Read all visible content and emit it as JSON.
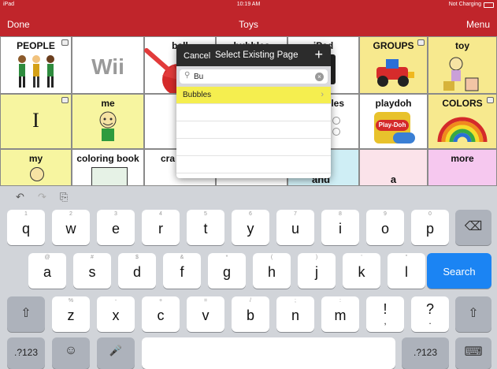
{
  "status_bar": {
    "device": "iPad",
    "time": "10:19 AM",
    "charging": "Not Charging"
  },
  "nav": {
    "done": "Done",
    "title": "Toys",
    "menu": "Menu"
  },
  "grid": {
    "people": "PEOPLE",
    "ball": "ball",
    "bubbles": "bubbles",
    "ipad": "iPad",
    "groups": "GROUPS",
    "toy": "toy",
    "i": "I",
    "me": "me",
    "les": "les",
    "playdoh": "playdoh",
    "colors": "COLORS",
    "my": "my",
    "coloring_book": "coloring book",
    "cra": "cra",
    "and": "and",
    "a": "a",
    "more": "more",
    "wii": "Wii",
    "playdoh_logo": "Play-Doh"
  },
  "popover": {
    "cancel": "Cancel",
    "title": "Select Existing Page",
    "plus": "+",
    "search_value": "Bu",
    "result": "Bubbles",
    "clear": "×",
    "chevron": "›",
    "mag": "⚲"
  },
  "keyboard": {
    "tools": {
      "undo": "↶",
      "redo": "↷",
      "paste": "⎘"
    },
    "row1": [
      {
        "hint": "1",
        "key": "q"
      },
      {
        "hint": "2",
        "key": "w"
      },
      {
        "hint": "3",
        "key": "e"
      },
      {
        "hint": "4",
        "key": "r"
      },
      {
        "hint": "5",
        "key": "t"
      },
      {
        "hint": "6",
        "key": "y"
      },
      {
        "hint": "7",
        "key": "u"
      },
      {
        "hint": "8",
        "key": "i"
      },
      {
        "hint": "9",
        "key": "o"
      },
      {
        "hint": "0",
        "key": "p"
      }
    ],
    "row2": [
      {
        "hint": "@",
        "key": "a"
      },
      {
        "hint": "#",
        "key": "s"
      },
      {
        "hint": "$",
        "key": "d"
      },
      {
        "hint": "&",
        "key": "f"
      },
      {
        "hint": "*",
        "key": "g"
      },
      {
        "hint": "(",
        "key": "h"
      },
      {
        "hint": ")",
        "key": "j"
      },
      {
        "hint": "'",
        "key": "k"
      },
      {
        "hint": "\"",
        "key": "l"
      }
    ],
    "row3": [
      {
        "hint": "%",
        "key": "z"
      },
      {
        "hint": "-",
        "key": "x"
      },
      {
        "hint": "+",
        "key": "c"
      },
      {
        "hint": "=",
        "key": "v"
      },
      {
        "hint": "/",
        "key": "b"
      },
      {
        "hint": ";",
        "key": "n"
      },
      {
        "hint": ":",
        "key": "m"
      },
      {
        "hint": "",
        "key": "!"
      },
      {
        "hint": "",
        "key": "?"
      }
    ],
    "row3_under": {
      "comma": ",",
      "period": "."
    },
    "delete": "⌫",
    "search": "Search",
    "shift": "⇧",
    "numbers_left": ".?123",
    "numbers_right": ".?123",
    "emoji": "☺",
    "mic": "🎤",
    "hide_keyboard": "⌨"
  }
}
